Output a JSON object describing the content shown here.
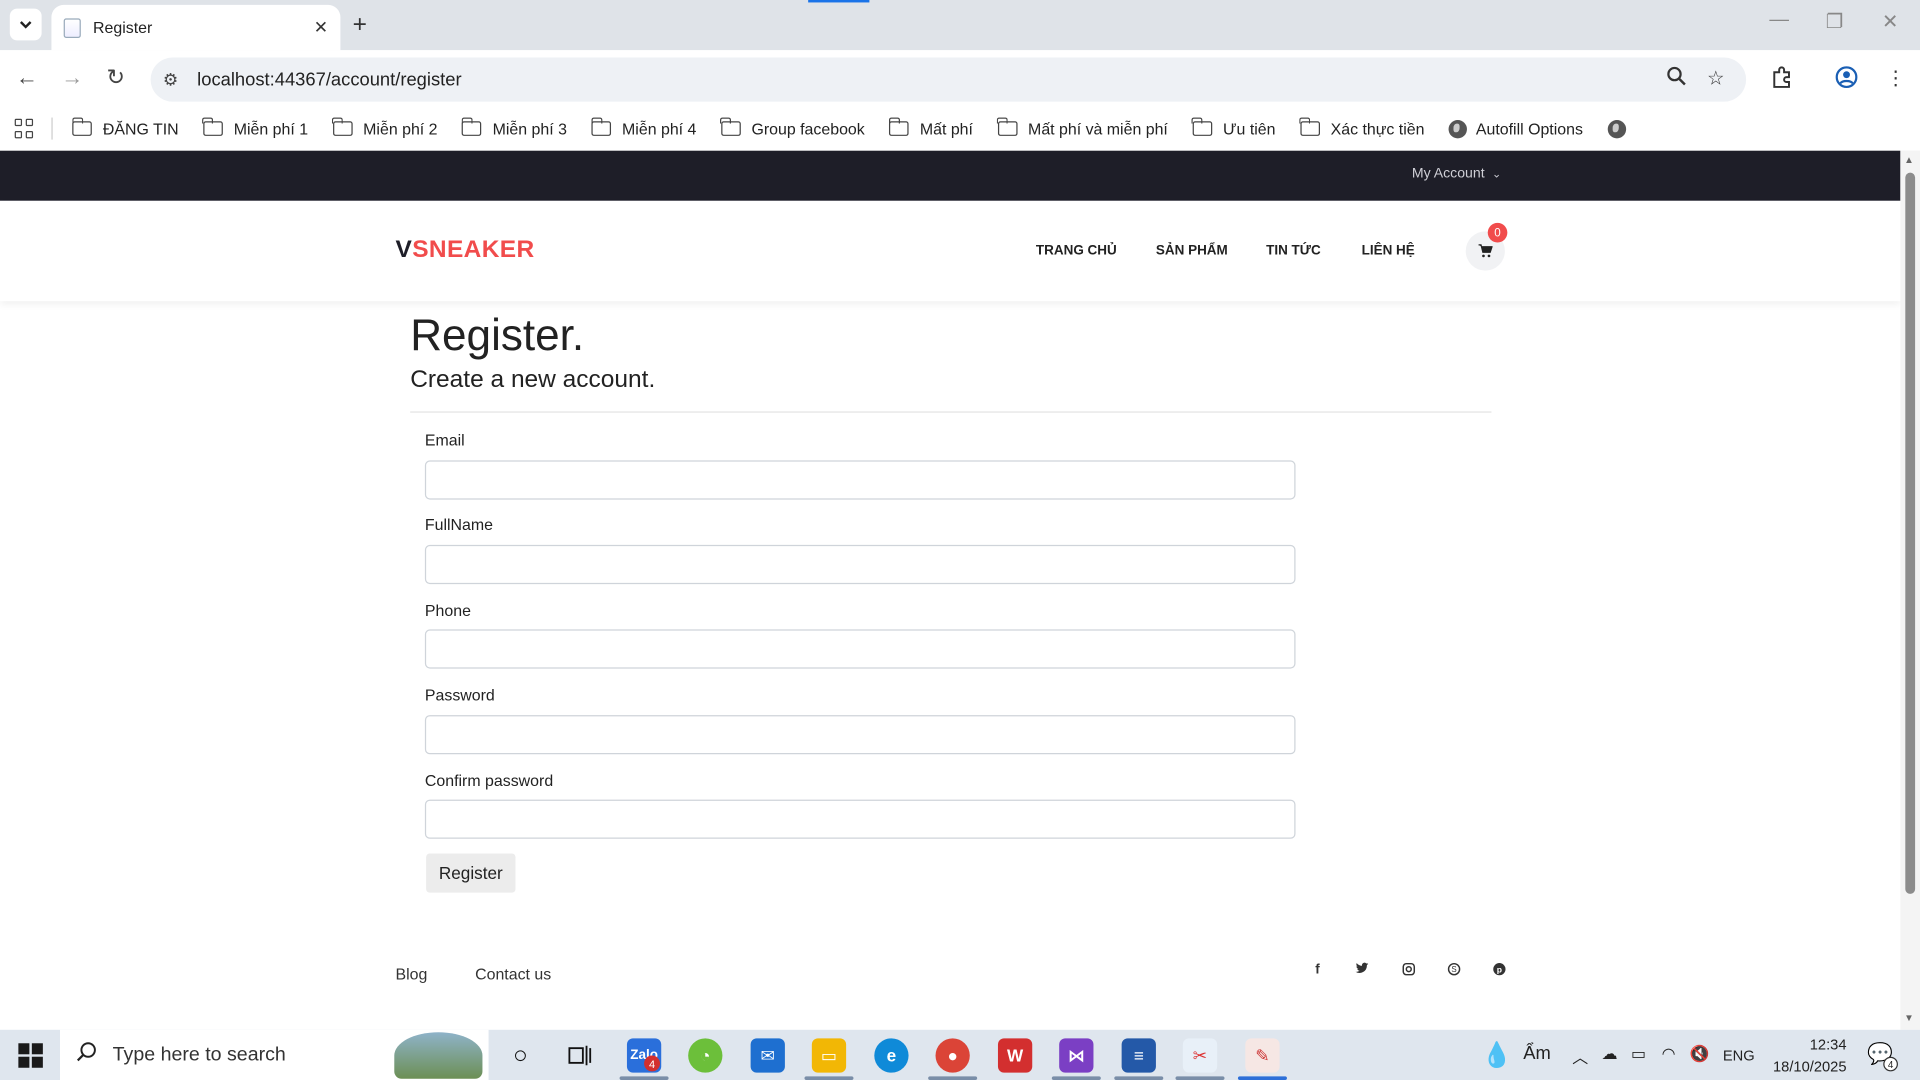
{
  "browser": {
    "tab_title": "Register",
    "url": "localhost:44367/account/register",
    "bookmarks": [
      "ĐĂNG TIN",
      "Miễn phí 1",
      "Miễn phí 2",
      "Miễn phí 3",
      "Miễn phí 4",
      "Group facebook",
      "Mất phí",
      "Mất phí và miễn phí",
      "Ưu tiên",
      "Xác thực tiền"
    ],
    "autofill_label": "Autofill Options"
  },
  "site": {
    "my_account": "My Account",
    "logo_v": "V",
    "logo_rest": "SNEAKER",
    "nav": [
      "TRANG CHỦ",
      "SẢN PHẨM",
      "TIN TỨC",
      "LIÊN HỆ"
    ],
    "cart_count": "0"
  },
  "form": {
    "title": "Register.",
    "subtitle": "Create a new account.",
    "email_label": "Email",
    "fullname_label": "FullName",
    "phone_label": "Phone",
    "password_label": "Password",
    "confirm_label": "Confirm password",
    "email_value": "",
    "fullname_value": "",
    "phone_value": "",
    "password_value": "",
    "confirm_value": "",
    "submit_label": "Register"
  },
  "footer": {
    "links": [
      "Blog",
      "Contact us"
    ],
    "social_icons": [
      "facebook-icon",
      "twitter-icon",
      "instagram-icon",
      "skype-icon",
      "pinterest-icon"
    ]
  },
  "taskbar": {
    "search_placeholder": "Type here to search",
    "weather_text": "Ẩm",
    "language": "ENG",
    "time": "12:34",
    "date": "18/10/2025",
    "notification_count": "4",
    "zalo_badge": "4"
  },
  "colors": {
    "accent": "#f14c4c",
    "topbar": "#1e1e28"
  }
}
